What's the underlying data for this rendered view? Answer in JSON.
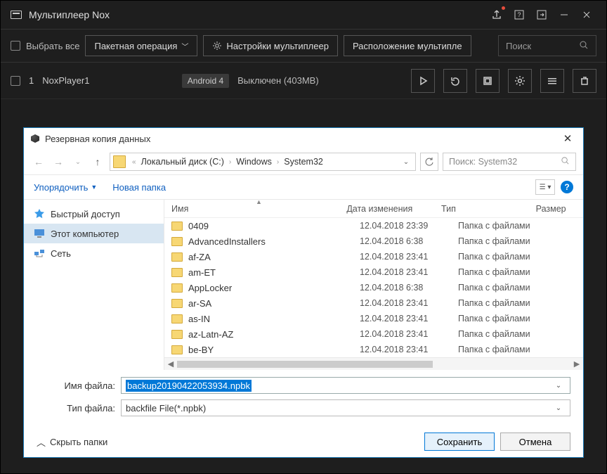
{
  "titlebar": {
    "title": "Мультиплеер Nox"
  },
  "toolbar": {
    "select_all": "Выбрать все",
    "batch_op": "Пакетная операция",
    "settings": "Настройки мультиплеер",
    "location": "Расположение мультипле",
    "search_placeholder": "Поиск"
  },
  "instance": {
    "index": "1",
    "name": "NoxPlayer1",
    "android": "Android 4",
    "status": "Выключен (403MB)"
  },
  "dialog": {
    "title": "Резервная копия данных",
    "breadcrumb": {
      "sep": "›",
      "root": "Локальный диск (C:)",
      "p1": "Windows",
      "p2": "System32"
    },
    "search_placeholder": "Поиск: System32",
    "organize": "Упорядочить",
    "new_folder": "Новая папка",
    "sidebar": {
      "quick": "Быстрый доступ",
      "pc": "Этот компьютер",
      "net": "Сеть"
    },
    "columns": {
      "name": "Имя",
      "date": "Дата изменения",
      "type": "Тип",
      "size": "Размер"
    },
    "type_label": "Папка с файлами",
    "files": [
      {
        "name": "0409",
        "date": "12.04.2018 23:39"
      },
      {
        "name": "AdvancedInstallers",
        "date": "12.04.2018 6:38"
      },
      {
        "name": "af-ZA",
        "date": "12.04.2018 23:41"
      },
      {
        "name": "am-ET",
        "date": "12.04.2018 23:41"
      },
      {
        "name": "AppLocker",
        "date": "12.04.2018 6:38"
      },
      {
        "name": "ar-SA",
        "date": "12.04.2018 23:41"
      },
      {
        "name": "as-IN",
        "date": "12.04.2018 23:41"
      },
      {
        "name": "az-Latn-AZ",
        "date": "12.04.2018 23:41"
      },
      {
        "name": "be-BY",
        "date": "12.04.2018 23:41"
      }
    ],
    "filename_label": "Имя файла:",
    "filetype_label": "Тип файла:",
    "filename_value": "backup20190422053934.npbk",
    "filetype_value": "backfile File(*.npbk)",
    "hide_folders": "Скрыть папки",
    "save": "Сохранить",
    "cancel": "Отмена"
  }
}
